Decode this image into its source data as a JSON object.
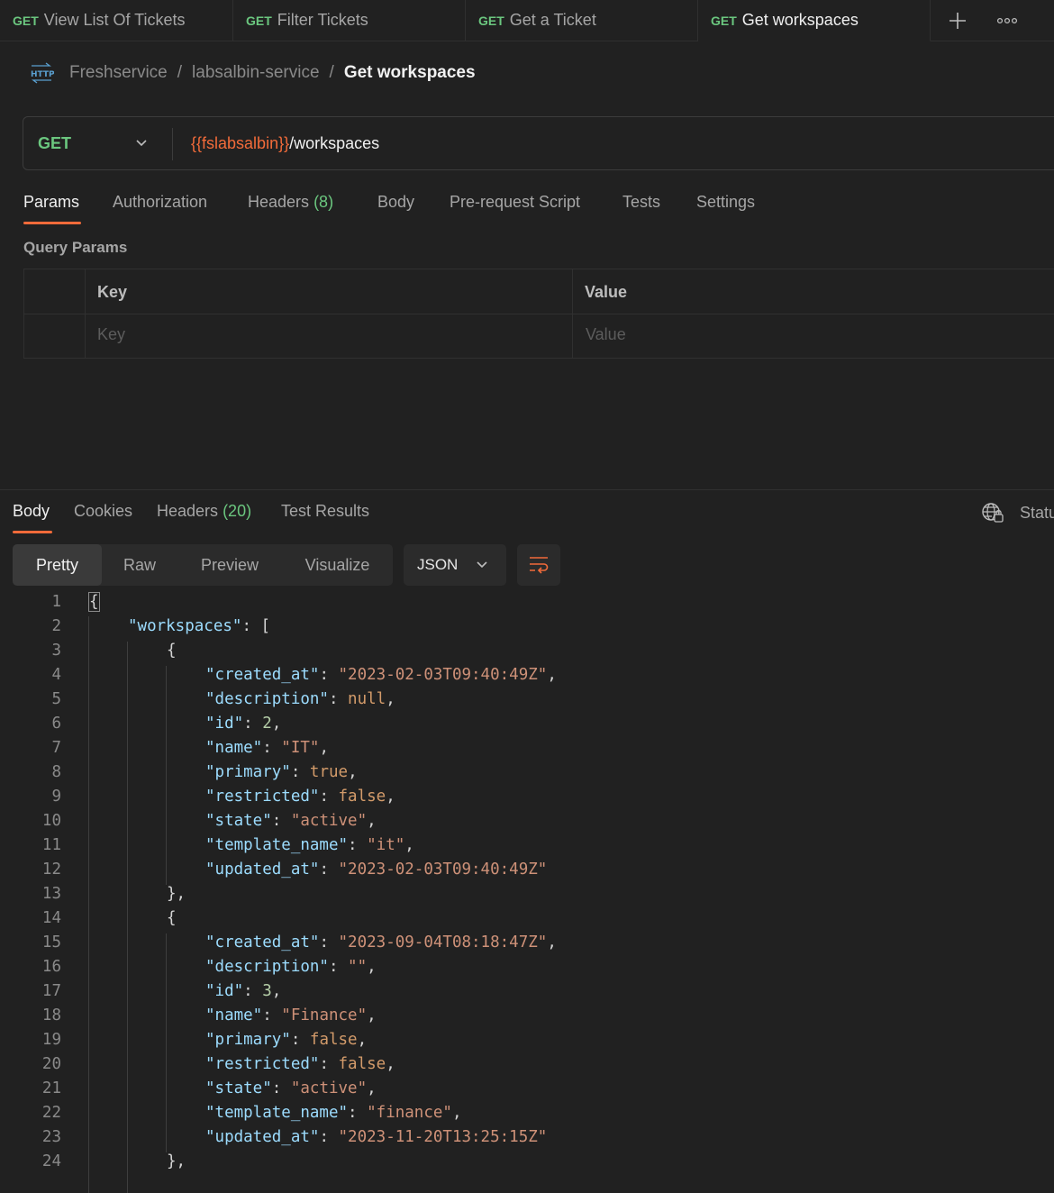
{
  "tabs": [
    {
      "method": "GET",
      "title": "View List Of Tickets"
    },
    {
      "method": "GET",
      "title": "Filter Tickets"
    },
    {
      "method": "GET",
      "title": "Get a Ticket"
    },
    {
      "method": "GET",
      "title": "Get workspaces"
    }
  ],
  "breadcrumb": {
    "collection": "Freshservice",
    "folder": "labsalbin-service",
    "request": "Get workspaces",
    "sep": "/"
  },
  "request": {
    "method": "GET",
    "url_variable": "{{fslabsalbin}}",
    "url_path": "/workspaces"
  },
  "request_tabs": {
    "params": "Params",
    "authorization": "Authorization",
    "headers": "Headers",
    "headers_count": "(8)",
    "body": "Body",
    "prerequest": "Pre-request Script",
    "tests": "Tests",
    "settings": "Settings"
  },
  "query_params": {
    "title": "Query Params",
    "headers": {
      "key": "Key",
      "value": "Value"
    },
    "placeholders": {
      "key": "Key",
      "value": "Value"
    }
  },
  "response_tabs": {
    "body": "Body",
    "cookies": "Cookies",
    "headers": "Headers",
    "headers_count": "(20)",
    "test_results": "Test Results",
    "status": "Statu"
  },
  "format": {
    "pretty": "Pretty",
    "raw": "Raw",
    "preview": "Preview",
    "visualize": "Visualize",
    "language": "JSON"
  },
  "colors": {
    "accent": "#f26b3a",
    "method_get": "#6bc77f",
    "background": "#212121"
  },
  "icons": {
    "http": "http-icon",
    "chevron": "chevron-down-icon",
    "new_tab": "plus-icon",
    "more": "more-icon",
    "globe": "globe-icon",
    "wrap": "wrap-lines-icon"
  },
  "code_lines": [
    {
      "n": "1",
      "indent": 0,
      "parts": [
        {
          "t": "{",
          "c": "p"
        }
      ]
    },
    {
      "n": "2",
      "indent": 1,
      "parts": [
        {
          "t": "\"workspaces\"",
          "c": "k"
        },
        {
          "t": ": [",
          "c": "p"
        }
      ]
    },
    {
      "n": "3",
      "indent": 2,
      "parts": [
        {
          "t": "{",
          "c": "p"
        }
      ]
    },
    {
      "n": "4",
      "indent": 3,
      "parts": [
        {
          "t": "\"created_at\"",
          "c": "k"
        },
        {
          "t": ": ",
          "c": "p"
        },
        {
          "t": "\"2023-02-03T09:40:49Z\"",
          "c": "s"
        },
        {
          "t": ",",
          "c": "p"
        }
      ]
    },
    {
      "n": "5",
      "indent": 3,
      "parts": [
        {
          "t": "\"description\"",
          "c": "k"
        },
        {
          "t": ": ",
          "c": "p"
        },
        {
          "t": "null",
          "c": "kw"
        },
        {
          "t": ",",
          "c": "p"
        }
      ]
    },
    {
      "n": "6",
      "indent": 3,
      "parts": [
        {
          "t": "\"id\"",
          "c": "k"
        },
        {
          "t": ": ",
          "c": "p"
        },
        {
          "t": "2",
          "c": "n"
        },
        {
          "t": ",",
          "c": "p"
        }
      ]
    },
    {
      "n": "7",
      "indent": 3,
      "parts": [
        {
          "t": "\"name\"",
          "c": "k"
        },
        {
          "t": ": ",
          "c": "p"
        },
        {
          "t": "\"IT\"",
          "c": "s"
        },
        {
          "t": ",",
          "c": "p"
        }
      ]
    },
    {
      "n": "8",
      "indent": 3,
      "parts": [
        {
          "t": "\"primary\"",
          "c": "k"
        },
        {
          "t": ": ",
          "c": "p"
        },
        {
          "t": "true",
          "c": "kw"
        },
        {
          "t": ",",
          "c": "p"
        }
      ]
    },
    {
      "n": "9",
      "indent": 3,
      "parts": [
        {
          "t": "\"restricted\"",
          "c": "k"
        },
        {
          "t": ": ",
          "c": "p"
        },
        {
          "t": "false",
          "c": "kw"
        },
        {
          "t": ",",
          "c": "p"
        }
      ]
    },
    {
      "n": "10",
      "indent": 3,
      "parts": [
        {
          "t": "\"state\"",
          "c": "k"
        },
        {
          "t": ": ",
          "c": "p"
        },
        {
          "t": "\"active\"",
          "c": "s"
        },
        {
          "t": ",",
          "c": "p"
        }
      ]
    },
    {
      "n": "11",
      "indent": 3,
      "parts": [
        {
          "t": "\"template_name\"",
          "c": "k"
        },
        {
          "t": ": ",
          "c": "p"
        },
        {
          "t": "\"it\"",
          "c": "s"
        },
        {
          "t": ",",
          "c": "p"
        }
      ]
    },
    {
      "n": "12",
      "indent": 3,
      "parts": [
        {
          "t": "\"updated_at\"",
          "c": "k"
        },
        {
          "t": ": ",
          "c": "p"
        },
        {
          "t": "\"2023-02-03T09:40:49Z\"",
          "c": "s"
        }
      ]
    },
    {
      "n": "13",
      "indent": 2,
      "parts": [
        {
          "t": "},",
          "c": "p"
        }
      ]
    },
    {
      "n": "14",
      "indent": 2,
      "parts": [
        {
          "t": "{",
          "c": "p"
        }
      ]
    },
    {
      "n": "15",
      "indent": 3,
      "parts": [
        {
          "t": "\"created_at\"",
          "c": "k"
        },
        {
          "t": ": ",
          "c": "p"
        },
        {
          "t": "\"2023-09-04T08:18:47Z\"",
          "c": "s"
        },
        {
          "t": ",",
          "c": "p"
        }
      ]
    },
    {
      "n": "16",
      "indent": 3,
      "parts": [
        {
          "t": "\"description\"",
          "c": "k"
        },
        {
          "t": ": ",
          "c": "p"
        },
        {
          "t": "\"\"",
          "c": "s"
        },
        {
          "t": ",",
          "c": "p"
        }
      ]
    },
    {
      "n": "17",
      "indent": 3,
      "parts": [
        {
          "t": "\"id\"",
          "c": "k"
        },
        {
          "t": ": ",
          "c": "p"
        },
        {
          "t": "3",
          "c": "n"
        },
        {
          "t": ",",
          "c": "p"
        }
      ]
    },
    {
      "n": "18",
      "indent": 3,
      "parts": [
        {
          "t": "\"name\"",
          "c": "k"
        },
        {
          "t": ": ",
          "c": "p"
        },
        {
          "t": "\"Finance\"",
          "c": "s"
        },
        {
          "t": ",",
          "c": "p"
        }
      ]
    },
    {
      "n": "19",
      "indent": 3,
      "parts": [
        {
          "t": "\"primary\"",
          "c": "k"
        },
        {
          "t": ": ",
          "c": "p"
        },
        {
          "t": "false",
          "c": "kw"
        },
        {
          "t": ",",
          "c": "p"
        }
      ]
    },
    {
      "n": "20",
      "indent": 3,
      "parts": [
        {
          "t": "\"restricted\"",
          "c": "k"
        },
        {
          "t": ": ",
          "c": "p"
        },
        {
          "t": "false",
          "c": "kw"
        },
        {
          "t": ",",
          "c": "p"
        }
      ]
    },
    {
      "n": "21",
      "indent": 3,
      "parts": [
        {
          "t": "\"state\"",
          "c": "k"
        },
        {
          "t": ": ",
          "c": "p"
        },
        {
          "t": "\"active\"",
          "c": "s"
        },
        {
          "t": ",",
          "c": "p"
        }
      ]
    },
    {
      "n": "22",
      "indent": 3,
      "parts": [
        {
          "t": "\"template_name\"",
          "c": "k"
        },
        {
          "t": ": ",
          "c": "p"
        },
        {
          "t": "\"finance\"",
          "c": "s"
        },
        {
          "t": ",",
          "c": "p"
        }
      ]
    },
    {
      "n": "23",
      "indent": 3,
      "parts": [
        {
          "t": "\"updated_at\"",
          "c": "k"
        },
        {
          "t": ": ",
          "c": "p"
        },
        {
          "t": "\"2023-11-20T13:25:15Z\"",
          "c": "s"
        }
      ]
    },
    {
      "n": "24",
      "indent": 2,
      "parts": [
        {
          "t": "},",
          "c": "p"
        }
      ]
    }
  ]
}
